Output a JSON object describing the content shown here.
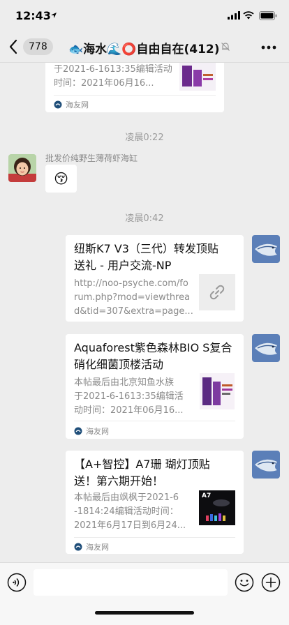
{
  "status": {
    "time": "12:43"
  },
  "nav": {
    "unread_count": "778",
    "title": "🐟海水🌊⭕自由自在(412)"
  },
  "messages": {
    "top_card": {
      "desc_line1": "于2021-6-1613:35编辑活动",
      "desc_line2": "时间：2021年06月16...",
      "source": "海友网"
    },
    "time1": "凌晨0:22",
    "sender_name": "批发价纯野生薄荷虾海缸",
    "sender_msg": "😚",
    "time2": "凌晨0:42",
    "card1": {
      "title_line1": "纽斯K7 V3（三代）转发顶贴",
      "title_line2": "送礼 - 用户交流-NP",
      "desc_line1": "http://noo-psyche.com/fo",
      "desc_line2": "rum.php?mod=viewthrea",
      "desc_line3": "d&tid=307&extra=page..."
    },
    "card2": {
      "title_line1": "Aquaforest紫色森林BIO S复合",
      "title_line2": "硝化细菌顶楼活动",
      "desc_line1": "本帖最后由北京知鱼水族",
      "desc_line2": "于2021-6-1613:35编辑活",
      "desc_line3": "动时间：2021年06月16...",
      "source": "海友网"
    },
    "card3": {
      "title_line1": "【A+智控】A7珊 瑚灯顶贴",
      "title_line2": "送！第六期开始！",
      "desc_line1": "本帖最后由飒枫于2021-6",
      "desc_line2": "-1814:24编辑活动时间：",
      "desc_line3": "2021年6月17日到6月24...",
      "thumb_label": "A7",
      "source": "海友网"
    }
  },
  "colors": {
    "background": "#ededed",
    "card": "#ffffff",
    "timestamp": "#9b9b9b"
  }
}
